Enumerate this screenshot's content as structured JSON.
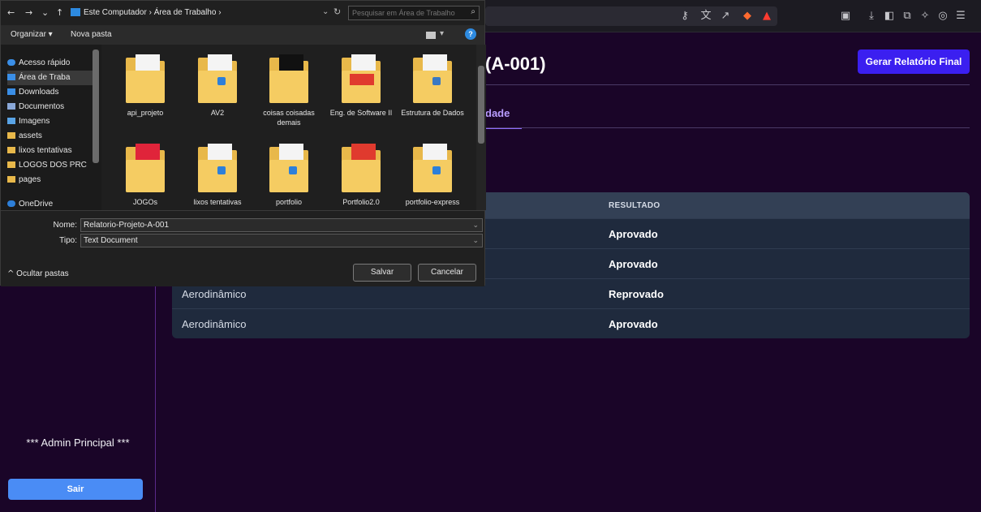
{
  "dialog": {
    "breadcrumb": "Este Computador  ›  Área de Trabalho  ›",
    "search_placeholder": "Pesquisar em Área de Trabalho",
    "organize": "Organizar ▾",
    "new_folder": "Nova pasta",
    "nav_items": [
      {
        "label": "Acesso rápido",
        "icon": "star-icon"
      },
      {
        "label": "Área de Traba",
        "icon": "desktop-icon"
      },
      {
        "label": "Downloads",
        "icon": "download-icon"
      },
      {
        "label": "Documentos",
        "icon": "document-icon"
      },
      {
        "label": "Imagens",
        "icon": "images-icon"
      },
      {
        "label": "assets",
        "icon": "folder-icon"
      },
      {
        "label": "lixos tentativas",
        "icon": "folder-icon"
      },
      {
        "label": "LOGOS DOS PRC",
        "icon": "folder-icon"
      },
      {
        "label": "pages",
        "icon": "folder-icon"
      },
      {
        "label": "OneDrive",
        "icon": "cloud-icon"
      }
    ],
    "files": [
      {
        "name": "api_projeto"
      },
      {
        "name": "AV2"
      },
      {
        "name": "coisas coisadas demais"
      },
      {
        "name": "Eng. de Software II"
      },
      {
        "name": "Estrutura de Dados"
      },
      {
        "name": "JOGOs"
      },
      {
        "name": "lixos tentativas"
      },
      {
        "name": "portfolio"
      },
      {
        "name": "Portfolio2.0"
      },
      {
        "name": "portfolio-express"
      }
    ],
    "name_label": "Nome:",
    "name_value": "Relatorio-Projeto-A-001",
    "type_label": "Tipo:",
    "type_value": "Text Document",
    "hide_folders": "Ocultar pastas",
    "save": "Salvar",
    "cancel": "Cancelar"
  },
  "app": {
    "title": "(A-001)",
    "report_button": "Gerar Relatório Final",
    "active_tab": "dade",
    "table": {
      "result_header": "RESULTADO",
      "rows": [
        {
          "test": "",
          "result": "Aprovado"
        },
        {
          "test": "",
          "result": "Aprovado"
        },
        {
          "test": "Aerodinâmico",
          "result": "Reprovado"
        },
        {
          "test": "Aerodinâmico",
          "result": "Aprovado"
        }
      ]
    },
    "admin_label": "*** Admin Principal ***",
    "logout": "Sair"
  },
  "colors": {
    "accent": "#3b1ff0",
    "background": "#1a0528",
    "logout": "#4a8cf5"
  }
}
